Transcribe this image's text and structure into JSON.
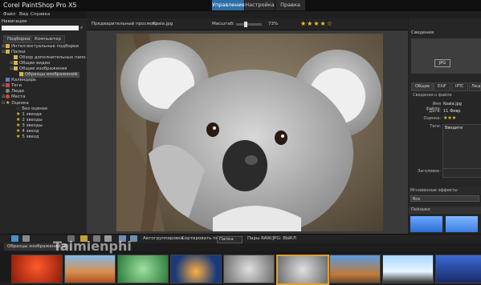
{
  "window": {
    "title": "Corel PaintShop Pro X5"
  },
  "mode_tabs": [
    {
      "label": "Управление"
    },
    {
      "label": "Настройка"
    },
    {
      "label": "Правка"
    }
  ],
  "menu": [
    {
      "label": "Файл"
    },
    {
      "label": "Вид"
    },
    {
      "label": "Справка"
    }
  ],
  "navigation": {
    "label": "Навигация",
    "tabs": [
      {
        "label": "Подборки"
      },
      {
        "label": "Компьютер"
      }
    ],
    "tree": [
      {
        "label": "Интеллектуальные подборки",
        "icon": "folder"
      },
      {
        "label": "Папки",
        "icon": "folder"
      },
      {
        "label": "Обзор дополнительных папо",
        "icon": "folder"
      },
      {
        "label": "Общие видео",
        "icon": "folder"
      },
      {
        "label": "Общие изображения",
        "icon": "folder"
      },
      {
        "label": "Образцы изображений",
        "icon": "folder"
      },
      {
        "label": "Календарь",
        "icon": "calendar"
      },
      {
        "label": "Теги",
        "icon": "tag"
      },
      {
        "label": "Люди",
        "icon": "people"
      },
      {
        "label": "Места",
        "icon": "pin"
      },
      {
        "label": "Оценка",
        "icon": "star"
      },
      {
        "label": "Без оценок",
        "icon": "none"
      },
      {
        "label": "1 звезда",
        "icon": "star"
      },
      {
        "label": "2 звезды",
        "icon": "star"
      },
      {
        "label": "3 звезды",
        "icon": "star"
      },
      {
        "label": "4 звезд",
        "icon": "star"
      },
      {
        "label": "5 звезд",
        "icon": "star"
      }
    ]
  },
  "preview": {
    "label": "Предварительный просмотр",
    "file_name": "Koala.jpg",
    "zoom_label": "Масштаб:",
    "zoom_value": "73%",
    "rating": "★★★★☆"
  },
  "info_panel": {
    "title": "Сведения",
    "jpg_badge": "JPG",
    "tabs": [
      {
        "label": "Общие"
      },
      {
        "label": "EXIF"
      },
      {
        "label": "IPTC"
      },
      {
        "label": "Люди"
      }
    ],
    "section_label": "Сведения о файле",
    "fields": [
      {
        "label": "Имя файла:",
        "value": "Koala.jpg"
      },
      {
        "label": "Дата:",
        "value": "11 Февр"
      },
      {
        "label": "Оценка:",
        "value": "★★★"
      },
      {
        "label": "Теги:",
        "value": "Введите"
      }
    ],
    "title_field_label": "Заголовок:"
  },
  "effects": {
    "title": "Мгновенные эффекты",
    "select_value": "Все",
    "category": "Пейзажи"
  },
  "bottom_toolbar": {
    "autogroup": "Автогруппировка",
    "sort_label": "Сортировать по:",
    "sort_value": "Папка",
    "pairs_label": "Пары RAW/JPG: ВЫКЛ"
  },
  "tray": {
    "tab_label": "Образцы изображений (8)"
  },
  "watermark": "Taimienphi",
  "colors": {
    "accent_tab": "#2f6fa8",
    "star": "#f2c321"
  }
}
